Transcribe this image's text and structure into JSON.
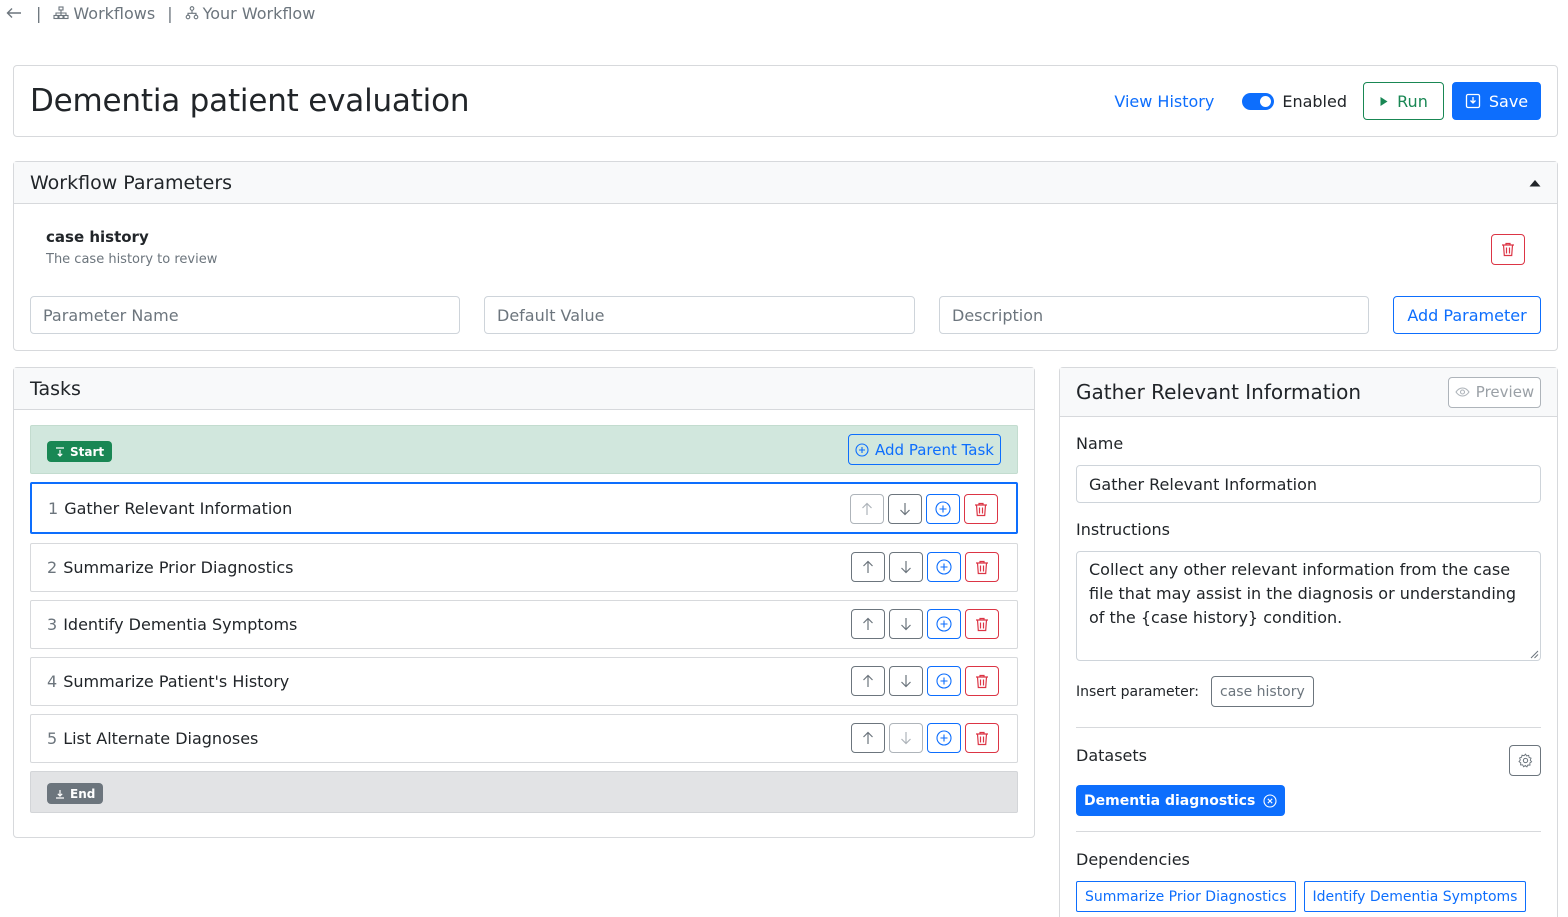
{
  "breadcrumb": {
    "items": [
      "Workflows",
      "Your Workflow"
    ],
    "separator": "|"
  },
  "header": {
    "title": "Dementia patient evaluation",
    "view_history": "View History",
    "enabled_label": "Enabled",
    "enabled": true,
    "run_label": "Run",
    "save_label": "Save"
  },
  "params": {
    "title": "Workflow Parameters",
    "items": [
      {
        "name": "case history",
        "description": "The case history to review"
      }
    ],
    "name_placeholder": "Parameter Name",
    "default_placeholder": "Default Value",
    "description_placeholder": "Description",
    "add_label": "Add Parameter"
  },
  "tasks": {
    "title": "Tasks",
    "start_label": "Start",
    "end_label": "End",
    "add_parent_label": "Add Parent Task",
    "items": [
      {
        "num": "1",
        "name": "Gather Relevant Information",
        "selected": true
      },
      {
        "num": "2",
        "name": "Summarize Prior Diagnostics",
        "selected": false
      },
      {
        "num": "3",
        "name": "Identify Dementia Symptoms",
        "selected": false
      },
      {
        "num": "4",
        "name": "Summarize Patient's History",
        "selected": false
      },
      {
        "num": "5",
        "name": "List Alternate Diagnoses",
        "selected": false
      }
    ]
  },
  "detail": {
    "title": "Gather Relevant Information",
    "preview_label": "Preview",
    "name_label": "Name",
    "name_value": "Gather Relevant Information",
    "instructions_label": "Instructions",
    "instructions_value": "Collect any other relevant information from the case file that may assist in the diagnosis or understanding of the  {case history} condition.",
    "insert_label": "Insert parameter:",
    "insert_chip": "case history",
    "datasets_label": "Datasets",
    "dataset": "Dementia diagnostics",
    "dependencies_label": "Dependencies",
    "dependencies": [
      "Summarize Prior Diagnostics",
      "Identify Dementia Symptoms"
    ]
  },
  "colors": {
    "primary": "#0d6efd",
    "success": "#198754",
    "danger": "#dc3545",
    "start_bg": "#d1e7dd",
    "end_bg": "#e2e3e5"
  },
  "icons": [
    "back-arrow-icon",
    "workflow-icon",
    "play-icon",
    "save-icon",
    "trash-icon",
    "arrow-up-icon",
    "arrow-down-icon",
    "plus-circle-icon",
    "eye-icon",
    "gear-icon",
    "close-circle-icon",
    "start-icon",
    "end-icon",
    "caret-up-icon"
  ]
}
